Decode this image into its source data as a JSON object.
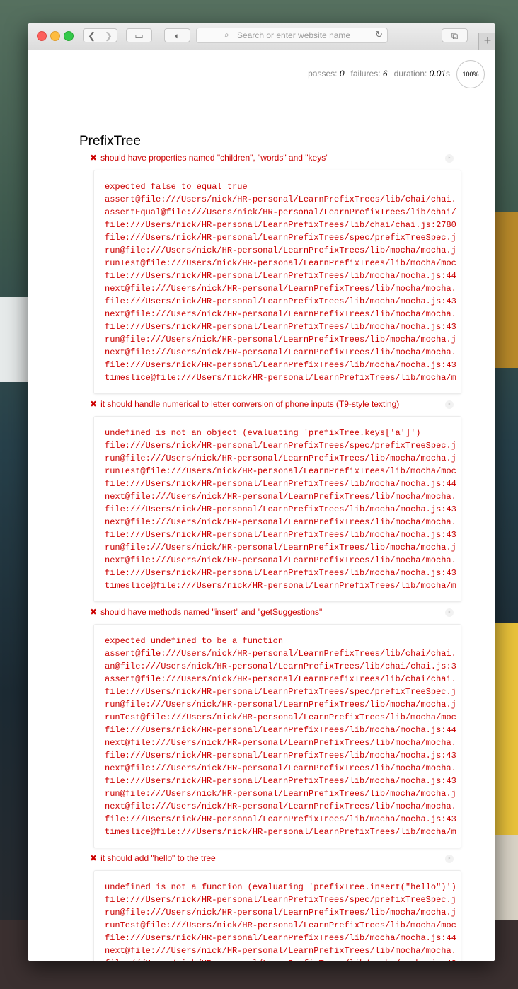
{
  "browser": {
    "address_placeholder": "Search or enter website name",
    "back_glyph": "❮",
    "forward_glyph": "❯",
    "sidebar_glyph": "▭",
    "share_glyph": "◐",
    "tabs_glyph": "⧉",
    "reload_glyph": "↻",
    "search_glyph": "⌕",
    "new_tab_glyph": "+"
  },
  "stats": {
    "passes_label": "passes:",
    "passes": "0",
    "failures_label": "failures:",
    "failures": "6",
    "duration_label": "duration:",
    "duration": "0.01",
    "duration_unit": "s",
    "progress": "100%"
  },
  "suite": {
    "title": "PrefixTree",
    "tests": [
      {
        "title": "should have properties named \"children\", \"words\" and \"keys\"",
        "error_lines": [
          "expected false to equal true",
          "assert@file:///Users/nick/HR-personal/LearnPrefixTrees/lib/chai/chai.",
          "assertEqual@file:///Users/nick/HR-personal/LearnPrefixTrees/lib/chai/",
          "file:///Users/nick/HR-personal/LearnPrefixTrees/lib/chai/chai.js:2780",
          "file:///Users/nick/HR-personal/LearnPrefixTrees/spec/prefixTreeSpec.j",
          "run@file:///Users/nick/HR-personal/LearnPrefixTrees/lib/mocha/mocha.j",
          "runTest@file:///Users/nick/HR-personal/LearnPrefixTrees/lib/mocha/moc",
          "file:///Users/nick/HR-personal/LearnPrefixTrees/lib/mocha/mocha.js:44",
          "next@file:///Users/nick/HR-personal/LearnPrefixTrees/lib/mocha/mocha.",
          "file:///Users/nick/HR-personal/LearnPrefixTrees/lib/mocha/mocha.js:43",
          "next@file:///Users/nick/HR-personal/LearnPrefixTrees/lib/mocha/mocha.",
          "file:///Users/nick/HR-personal/LearnPrefixTrees/lib/mocha/mocha.js:43",
          "run@file:///Users/nick/HR-personal/LearnPrefixTrees/lib/mocha/mocha.j",
          "next@file:///Users/nick/HR-personal/LearnPrefixTrees/lib/mocha/mocha.",
          "file:///Users/nick/HR-personal/LearnPrefixTrees/lib/mocha/mocha.js:43",
          "timeslice@file:///Users/nick/HR-personal/LearnPrefixTrees/lib/mocha/m"
        ]
      },
      {
        "title": "it should handle numerical to letter conversion of phone inputs (T9-style texting)",
        "error_lines": [
          "undefined is not an object (evaluating 'prefixTree.keys['a']')",
          "file:///Users/nick/HR-personal/LearnPrefixTrees/spec/prefixTreeSpec.j",
          "run@file:///Users/nick/HR-personal/LearnPrefixTrees/lib/mocha/mocha.j",
          "runTest@file:///Users/nick/HR-personal/LearnPrefixTrees/lib/mocha/moc",
          "file:///Users/nick/HR-personal/LearnPrefixTrees/lib/mocha/mocha.js:44",
          "next@file:///Users/nick/HR-personal/LearnPrefixTrees/lib/mocha/mocha.",
          "file:///Users/nick/HR-personal/LearnPrefixTrees/lib/mocha/mocha.js:43",
          "next@file:///Users/nick/HR-personal/LearnPrefixTrees/lib/mocha/mocha.",
          "file:///Users/nick/HR-personal/LearnPrefixTrees/lib/mocha/mocha.js:43",
          "run@file:///Users/nick/HR-personal/LearnPrefixTrees/lib/mocha/mocha.j",
          "next@file:///Users/nick/HR-personal/LearnPrefixTrees/lib/mocha/mocha.",
          "file:///Users/nick/HR-personal/LearnPrefixTrees/lib/mocha/mocha.js:43",
          "timeslice@file:///Users/nick/HR-personal/LearnPrefixTrees/lib/mocha/m"
        ]
      },
      {
        "title": "should have methods named \"insert\" and \"getSuggestions\"",
        "error_lines": [
          "expected undefined to be a function",
          "assert@file:///Users/nick/HR-personal/LearnPrefixTrees/lib/chai/chai.",
          "an@file:///Users/nick/HR-personal/LearnPrefixTrees/lib/chai/chai.js:3",
          "assert@file:///Users/nick/HR-personal/LearnPrefixTrees/lib/chai/chai.",
          "file:///Users/nick/HR-personal/LearnPrefixTrees/spec/prefixTreeSpec.j",
          "run@file:///Users/nick/HR-personal/LearnPrefixTrees/lib/mocha/mocha.j",
          "runTest@file:///Users/nick/HR-personal/LearnPrefixTrees/lib/mocha/moc",
          "file:///Users/nick/HR-personal/LearnPrefixTrees/lib/mocha/mocha.js:44",
          "next@file:///Users/nick/HR-personal/LearnPrefixTrees/lib/mocha/mocha.",
          "file:///Users/nick/HR-personal/LearnPrefixTrees/lib/mocha/mocha.js:43",
          "next@file:///Users/nick/HR-personal/LearnPrefixTrees/lib/mocha/mocha.",
          "file:///Users/nick/HR-personal/LearnPrefixTrees/lib/mocha/mocha.js:43",
          "run@file:///Users/nick/HR-personal/LearnPrefixTrees/lib/mocha/mocha.j",
          "next@file:///Users/nick/HR-personal/LearnPrefixTrees/lib/mocha/mocha.",
          "file:///Users/nick/HR-personal/LearnPrefixTrees/lib/mocha/mocha.js:43",
          "timeslice@file:///Users/nick/HR-personal/LearnPrefixTrees/lib/mocha/m"
        ]
      },
      {
        "title": "it should add \"hello\" to the tree",
        "error_lines": [
          "undefined is not a function (evaluating 'prefixTree.insert(\"hello\")')",
          "file:///Users/nick/HR-personal/LearnPrefixTrees/spec/prefixTreeSpec.j",
          "run@file:///Users/nick/HR-personal/LearnPrefixTrees/lib/mocha/mocha.j",
          "runTest@file:///Users/nick/HR-personal/LearnPrefixTrees/lib/mocha/moc",
          "file:///Users/nick/HR-personal/LearnPrefixTrees/lib/mocha/mocha.js:44",
          "next@file:///Users/nick/HR-personal/LearnPrefixTrees/lib/mocha/mocha.",
          "file:///Users/nick/HR-personal/LearnPrefixTrees/lib/mocha/mocha.js:43",
          "next@file:///Users/nick/HR-personal/LearnPrefixTrees/lib/mocha/mocha."
        ]
      }
    ],
    "fail_glyph": "✖",
    "replay_glyph": "‣"
  }
}
